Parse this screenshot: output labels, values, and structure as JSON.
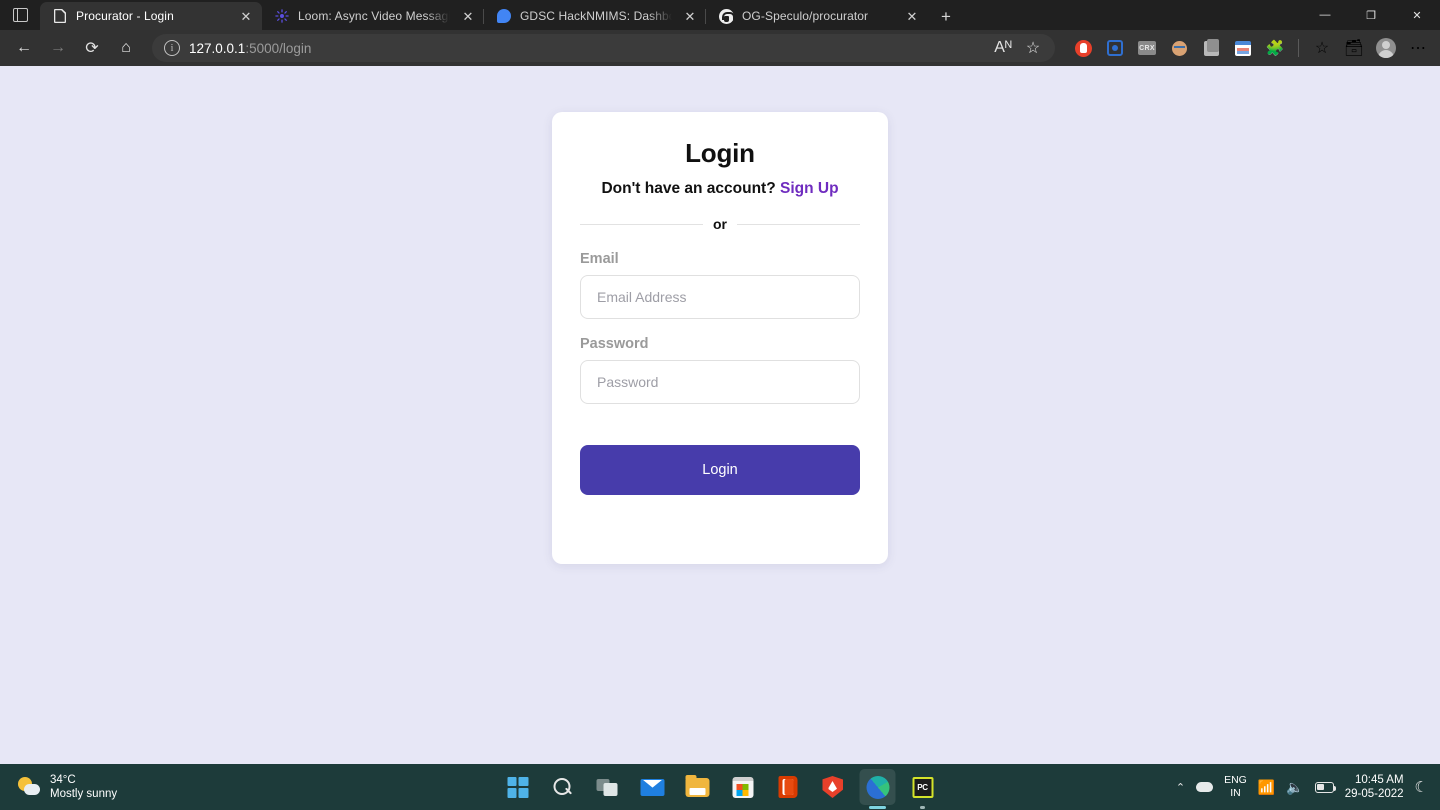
{
  "browser": {
    "sidebar_toggle_icon": "split-pane-icon",
    "tabs": [
      {
        "title": "Procurator - Login",
        "favicon": "document-icon",
        "active": true
      },
      {
        "title": "Loom: Async Video Messaging f",
        "favicon": "loom-icon",
        "active": false
      },
      {
        "title": "GDSC HackNMIMS: Dashboard |",
        "favicon": "gdsc-icon",
        "active": false
      },
      {
        "title": "OG-Speculo/procurator",
        "favicon": "github-icon",
        "active": false
      }
    ],
    "new_tab_label": "+",
    "window_controls": {
      "minimize": "—",
      "maximize": "❐",
      "close": "✕"
    },
    "nav": {
      "back": "←",
      "forward": "→",
      "refresh": "⟳",
      "home": "⌂"
    },
    "address": {
      "host": "127.0.0.1",
      "rest": ":5000/login",
      "site_info_icon": "info-icon"
    },
    "omnibox_actions": {
      "read_aloud": "Aᴺ",
      "add_favorite": "☆"
    },
    "extensions": [
      "brave-shield-icon",
      "blue-square-icon",
      "crx-icon",
      "face-icon",
      "docs-icon",
      "calendar-icon",
      "puzzle-icon"
    ],
    "toolbar_right": {
      "collections_icon": "collections-icon",
      "favorites_icon": "favorites-icon",
      "profile_icon": "avatar-icon",
      "settings_icon": "ellipsis-icon"
    }
  },
  "login": {
    "title": "Login",
    "signup_prompt": "Don't have an account?",
    "signup_link": "Sign Up",
    "divider_label": "or",
    "email": {
      "label": "Email",
      "placeholder": "Email Address",
      "value": ""
    },
    "password": {
      "label": "Password",
      "placeholder": "Password",
      "value": ""
    },
    "submit_label": "Login",
    "colors": {
      "accent": "#473cab",
      "link": "#6f2cbf",
      "page_background": "#e7e7f6"
    }
  },
  "taskbar": {
    "weather": {
      "temperature": "34°C",
      "condition": "Mostly sunny",
      "icon": "sun-cloud-icon"
    },
    "apps": [
      {
        "name": "start-button",
        "icon": "windows-icon"
      },
      {
        "name": "search-button",
        "icon": "search-icon"
      },
      {
        "name": "task-view-button",
        "icon": "task-view-icon"
      },
      {
        "name": "mail-button",
        "icon": "mail-icon"
      },
      {
        "name": "file-explorer-button",
        "icon": "folder-icon"
      },
      {
        "name": "microsoft-store-button",
        "icon": "store-icon"
      },
      {
        "name": "office-button",
        "icon": "office-icon"
      },
      {
        "name": "brave-button",
        "icon": "brave-icon"
      },
      {
        "name": "edge-button",
        "icon": "edge-icon"
      },
      {
        "name": "pycharm-button",
        "icon": "pycharm-icon",
        "label": "PC"
      }
    ],
    "tray": {
      "show_hidden_icons": "⌃",
      "weather_icon": "cloud-icon",
      "language_line1": "ENG",
      "language_line2": "IN",
      "wifi_icon": "📶",
      "volume_icon": "🔊",
      "battery_icon": "battery-icon",
      "time": "10:45 AM",
      "date": "29-05-2022",
      "notifications_icon": "☾"
    }
  }
}
